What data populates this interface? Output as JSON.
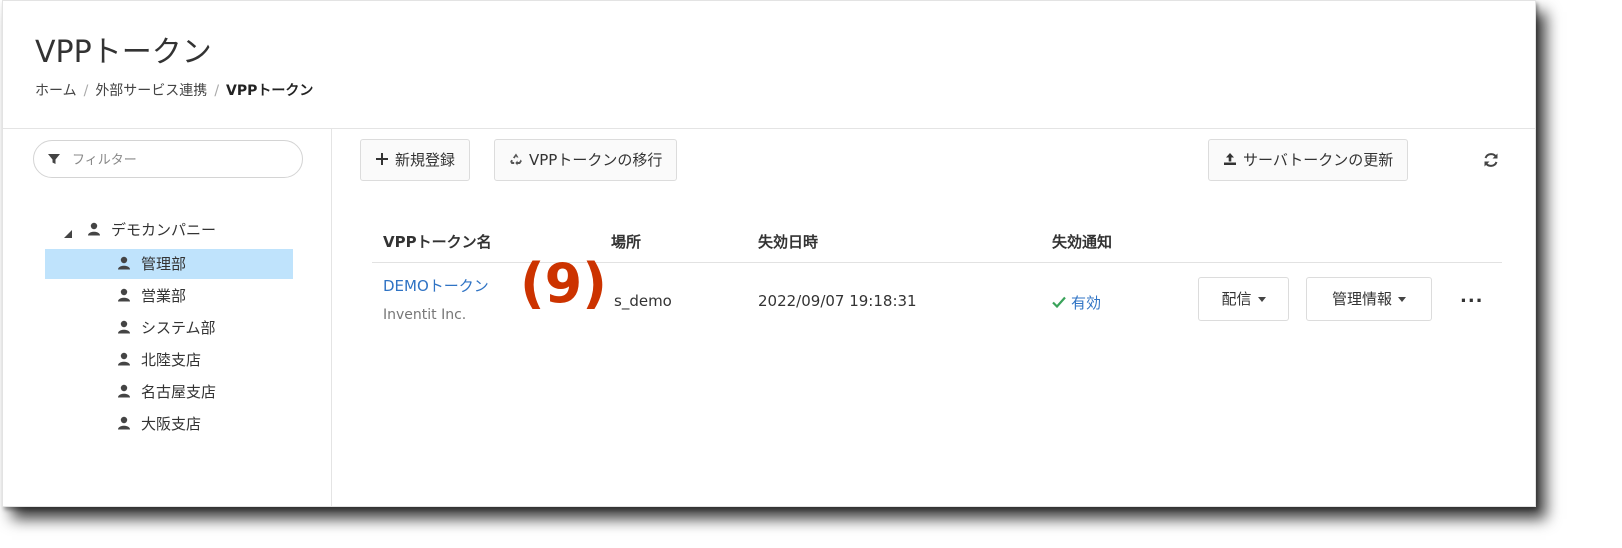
{
  "page": {
    "title": "VPPトークン",
    "breadcrumb": [
      "ホーム",
      "外部サービス連携",
      "VPPトークン"
    ]
  },
  "sidebar": {
    "filter_placeholder": "フィルター",
    "root": "デモカンパニー",
    "items": [
      {
        "label": "管理部",
        "selected": true
      },
      {
        "label": "営業部"
      },
      {
        "label": "システム部"
      },
      {
        "label": "北陸支店"
      },
      {
        "label": "名古屋支店"
      },
      {
        "label": "大阪支店"
      }
    ]
  },
  "toolbar": {
    "new_label": "新規登録",
    "migrate_label": "VPPトークンの移行",
    "update_label": "サーバトークンの更新"
  },
  "table": {
    "headers": [
      "VPPトークン名",
      "場所",
      "失効日時",
      "失効通知"
    ],
    "rows": [
      {
        "name": "DEMOトークン",
        "org": "Inventit Inc.",
        "location": "s_demo",
        "expires": "2022/09/07 19:18:31",
        "notify": "有効",
        "deliver_label": "配信",
        "manage_label": "管理情報",
        "more_label": "..."
      }
    ]
  },
  "annotation": "(9)",
  "colors": {
    "link": "#2f73c4",
    "selected": "#bfe3fc",
    "annotation": "#cc3300"
  }
}
